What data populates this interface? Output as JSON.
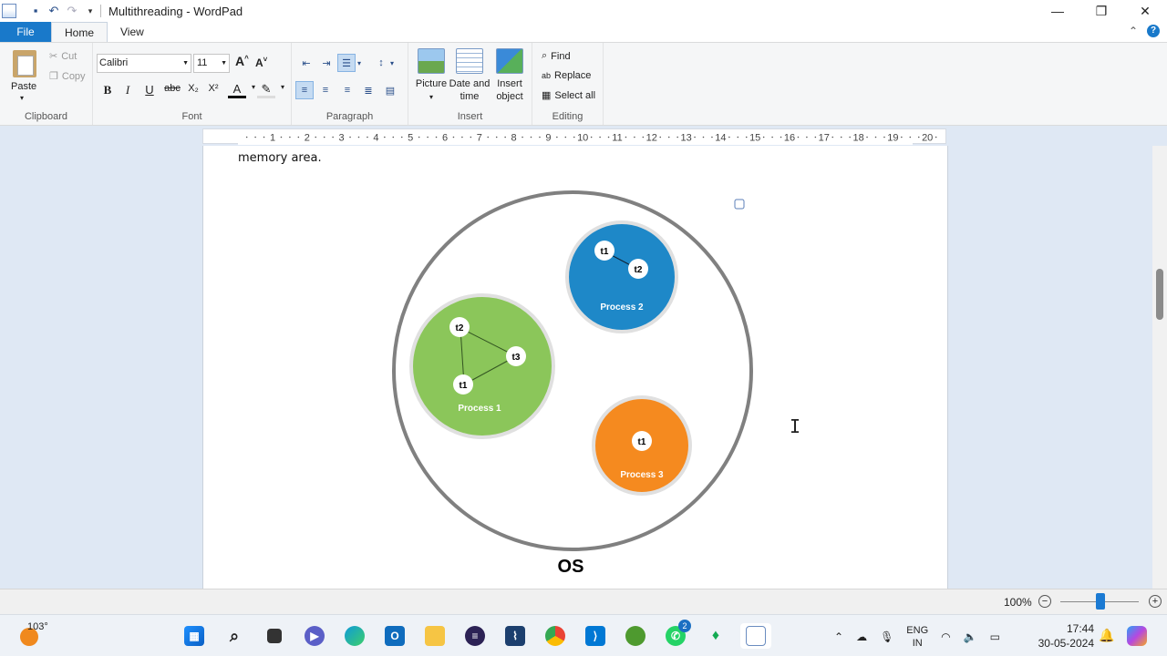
{
  "window": {
    "title": "Multithreading - WordPad",
    "controls": [
      "minimize",
      "maximize",
      "close"
    ]
  },
  "tabs": {
    "file": "File",
    "home": "Home",
    "view": "View"
  },
  "ribbon": {
    "clipboard": {
      "paste": "Paste",
      "cut": "Cut",
      "copy": "Copy",
      "label": "Clipboard"
    },
    "font": {
      "name": "Calibri",
      "size": "11",
      "label": "Font",
      "bold": "B",
      "italic": "I",
      "underline": "U",
      "strike": "abc",
      "subscript": "X₂",
      "superscript": "X²",
      "grow": "A^",
      "shrink": "A˅",
      "color": "A"
    },
    "paragraph": {
      "label": "Paragraph"
    },
    "insert": {
      "picture": "Picture",
      "datetime_line1": "Date and",
      "datetime_line2": "time",
      "object_line1": "Insert",
      "object_line2": "object",
      "label": "Insert"
    },
    "editing": {
      "find": "Find",
      "replace": "Replace",
      "select_all": "Select all",
      "label": "Editing"
    }
  },
  "ruler": {
    "numbers": "1 · 2 · 3 · 4 · 5 · 6 · 7 · 8 · 9 · 10 · 11 · 12 · 13 · 14 · 15 · 16 · 17 · 18 · 19 · 20"
  },
  "document": {
    "text": "memory area.",
    "diagram": {
      "os_label": "OS",
      "process1": {
        "label": "Process 1",
        "threads": [
          "t1",
          "t2",
          "t3"
        ],
        "color": "#8bc65a"
      },
      "process2": {
        "label": "Process 2",
        "threads": [
          "t1",
          "t2"
        ],
        "color": "#1e88c8"
      },
      "process3": {
        "label": "Process 3",
        "threads": [
          "t1"
        ],
        "color": "#f58a1f"
      }
    }
  },
  "statusbar": {
    "zoom": "100%"
  },
  "taskbar": {
    "temperature": "103°",
    "lang_line1": "ENG",
    "lang_line2": "IN",
    "time": "17:44",
    "date": "30-05-2024",
    "whatsapp_badge": "2",
    "apps": [
      "start",
      "search",
      "task-view",
      "teams",
      "edge",
      "outlook",
      "file-explorer",
      "eclipse",
      "wireshark",
      "chrome",
      "vscode",
      "unknown-green",
      "whatsapp",
      "mongodb",
      "wordpad"
    ]
  }
}
